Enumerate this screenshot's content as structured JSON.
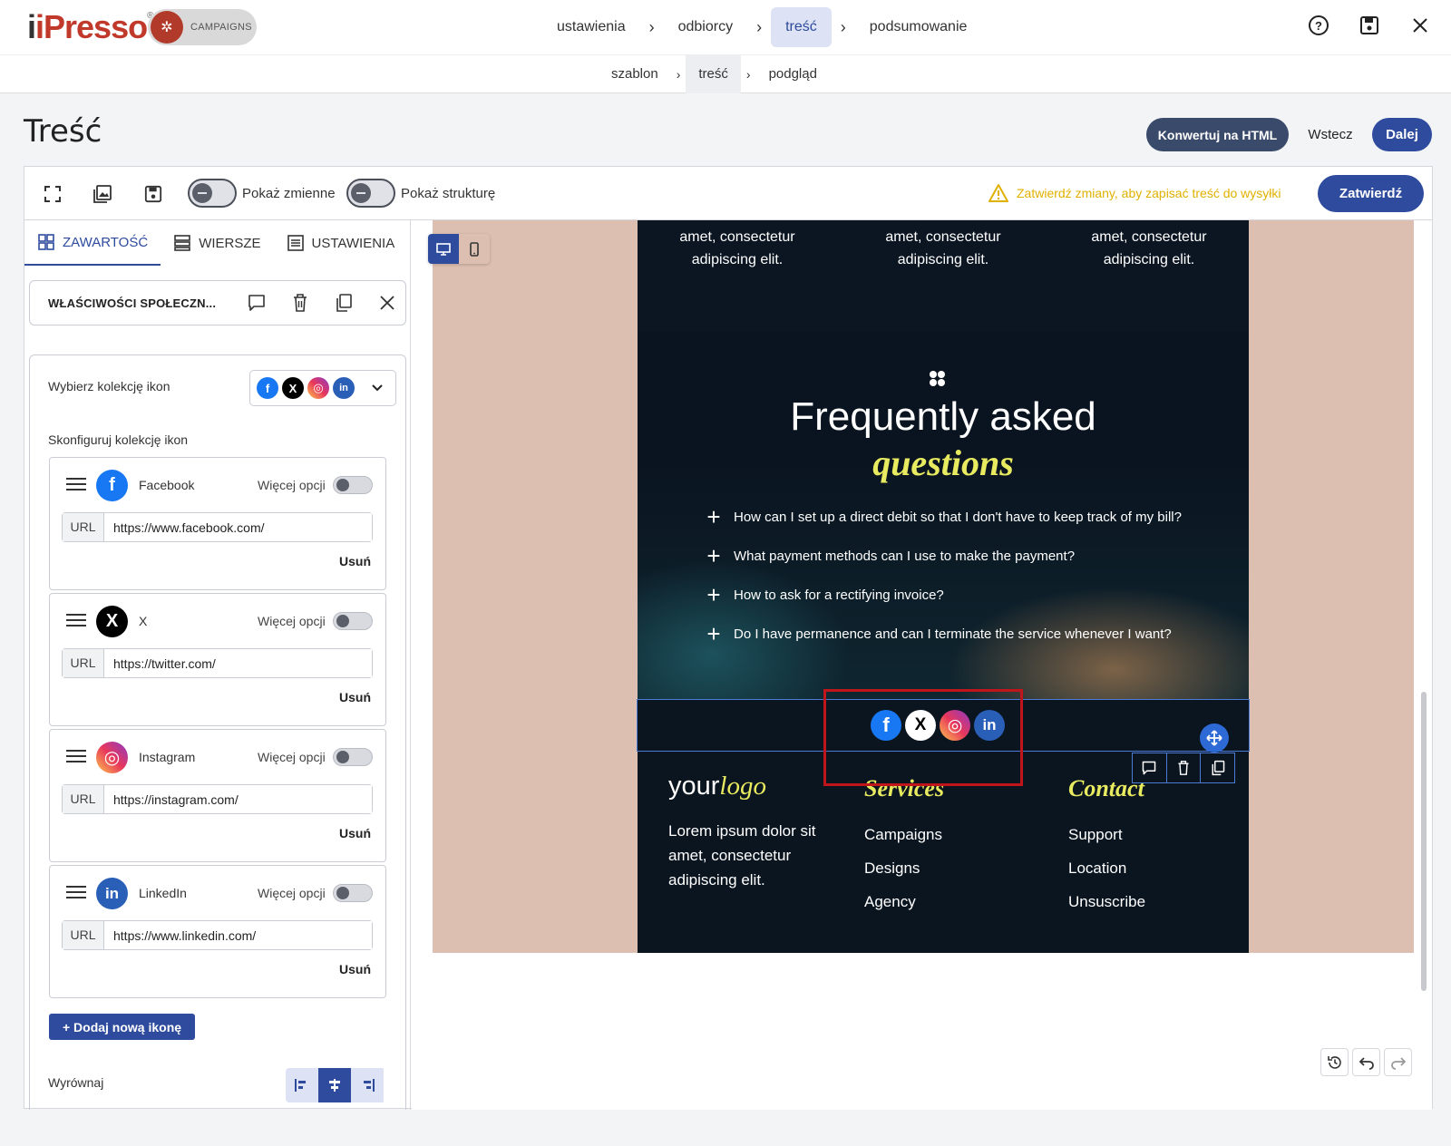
{
  "app": {
    "logo_text": "iPresso",
    "campaign_label": "CAMPAIGNS"
  },
  "steps": [
    {
      "label": "ustawienia",
      "active": false
    },
    {
      "label": "odbiorcy",
      "active": false
    },
    {
      "label": "treść",
      "active": true
    },
    {
      "label": "podsumowanie",
      "active": false
    }
  ],
  "substeps": [
    {
      "label": "szablon",
      "active": false
    },
    {
      "label": "treść",
      "active": true
    },
    {
      "label": "podgląd",
      "active": false
    }
  ],
  "top_icons": [
    "help-icon",
    "save-icon",
    "close-icon"
  ],
  "page": {
    "title": "Treść",
    "convert_html": "Konwertuj na HTML",
    "back": "Wstecz",
    "next": "Dalej"
  },
  "toolbar": {
    "show_variables": "Pokaż zmienne",
    "show_structure": "Pokaż strukturę",
    "warning": "Zatwierdź zmiany, aby zapisać treść do wysyłki",
    "confirm": "Zatwierdź"
  },
  "tabs": [
    {
      "label": "ZAWARTOŚĆ",
      "icon": "grid-icon",
      "active": true
    },
    {
      "label": "WIERSZE",
      "icon": "rows-icon",
      "active": false
    },
    {
      "label": "USTAWIENIA",
      "icon": "settings-doc-icon",
      "active": false
    }
  ],
  "properties": {
    "title": "WŁAŚCIWOŚCI SPOŁECZN...",
    "choose_collection": "Wybierz kolekcję ikon",
    "configure_collection": "Skonfiguruj kolekcję ikon",
    "more_options": "Więcej opcji",
    "url_label": "URL",
    "remove": "Usuń",
    "add_icon": "Dodaj nową ikonę",
    "align": "Wyrównaj",
    "icons": [
      {
        "name": "Facebook",
        "url": "https://www.facebook.com/",
        "color": "#1877f2",
        "glyph": "f"
      },
      {
        "name": "X",
        "url": "https://twitter.com/",
        "color": "#000000",
        "glyph": "𝕏"
      },
      {
        "name": "Instagram",
        "url": "https://instagram.com/",
        "color": "#d6249f",
        "glyph": "◎"
      },
      {
        "name": "LinkedIn",
        "url": "https://www.linkedin.com/",
        "color": "#2a5fb8",
        "glyph": "in"
      }
    ]
  },
  "email": {
    "top_cols": [
      "amet, consectetur adipiscing elit.",
      "amet, consectetur adipiscing elit.",
      "amet, consectetur adipiscing elit."
    ],
    "faq_title": "Frequently asked",
    "faq_subtitle": "questions",
    "faq_items": [
      "How can I set up a direct debit so that I don't have to keep track of my bill?",
      "What payment methods can I use to make the payment?",
      "How to ask for a rectifying invoice?",
      "Do I have permanence and can I terminate the service whenever I want?"
    ],
    "logo_plain": "your",
    "logo_italic": "logo",
    "footer_text": "Lorem ipsum dolor sit amet, consectetur adipiscing elit.",
    "services_title": "Services",
    "services": [
      "Campaigns",
      "Designs",
      "Agency"
    ],
    "contact_title": "Contact",
    "contact": [
      "Support",
      "Location",
      "Unsuscribe"
    ]
  }
}
